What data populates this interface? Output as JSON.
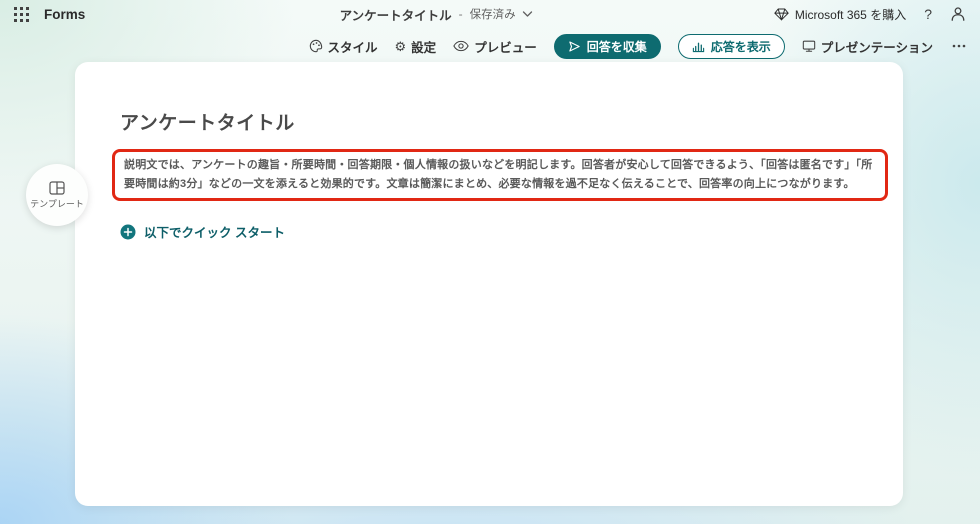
{
  "header": {
    "app_name": "Forms",
    "doc_title": "アンケートタイトル",
    "separator": "-",
    "saved_status": "保存済み",
    "buy_label": "Microsoft 365 を購入",
    "help_label": "?"
  },
  "toolbar": {
    "style_label": "スタイル",
    "settings_label": "設定",
    "settings_icon_glyph": "⚙",
    "preview_label": "プレビュー",
    "collect_label": "回答を収集",
    "responses_label": "応答を表示",
    "presentation_label": "プレゼンテーション"
  },
  "form": {
    "title": "アンケートタイトル",
    "description": "説明文では、アンケートの趣旨・所要時間・回答期限・個人情報の扱いなどを明記します。回答者が安心して回答できるよう、「回答は匿名です」「所要時間は約3分」などの一文を添えると効果的です。文章は簡潔にまとめ、必要な情報を過不足なく伝えることで、回答率の向上につながります。",
    "quick_start_label": "以下でクイック スタート"
  },
  "sidebar": {
    "template_label": "テンプレート"
  },
  "colors": {
    "teal_button": "#0e6b70",
    "teal_link": "#0d5e68",
    "annotation_red": "#e12814"
  }
}
